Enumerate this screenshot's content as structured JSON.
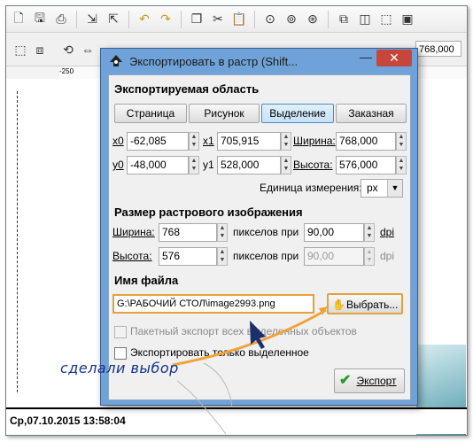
{
  "toolbar": {
    "icons": [
      "new-doc-icon",
      "save-icon",
      "print-icon",
      "import-icon",
      "export-icon",
      "undo-icon",
      "redo-icon",
      "copy-icon",
      "cut-icon",
      "paste-icon",
      "zoom-selection-icon",
      "zoom-drawing-icon",
      "zoom-page-icon",
      "duplicate-icon",
      "clone-icon",
      "unlink-icon"
    ],
    "w_value": "768,000"
  },
  "ruler": {
    "mark": "-250"
  },
  "dialog": {
    "title": "Экспортировать в растр (Shift...",
    "close_label": "✕",
    "minimize_label": "—",
    "export_area": {
      "heading": "Экспортируемая область",
      "buttons": [
        "Страница",
        "Рисунок",
        "Выделение",
        "Заказная"
      ],
      "active": "Выделение",
      "x0_label": "x0",
      "x0_value": "-62,085",
      "x1_label": "x1",
      "x1_value": "705,915",
      "width_label": "Ширина:",
      "width_value": "768,000",
      "y0_label": "y0",
      "y0_value": "-48,000",
      "y1_label": "y1",
      "y1_value": "528,000",
      "height_label": "Высота:",
      "height_value": "576,000",
      "units_label": "Единица измерения:",
      "units_value": "px"
    },
    "bitmap_size": {
      "heading": "Размер растрового изображения",
      "width_label": "Ширина:",
      "width_value": "768",
      "pixels_at_label": "пикселов при",
      "dpi_value": "90,00",
      "dpi_unit": "dpi",
      "height_label": "Высота:",
      "height_value": "576",
      "pixels_at_label2": "пикселов при",
      "dpi_value2": "90,00",
      "dpi_unit2": "dpi"
    },
    "filename": {
      "heading": "Имя файла",
      "path": "G:\\РАБОЧИЙ СТОЛ\\image2993.png",
      "browse_label": "Выбрать..."
    },
    "batch_label": "Пакетный экспорт всех выделенных объектов",
    "selected_only_label": "Экспортировать только выделенное",
    "export_button": "Экспорт"
  },
  "annotation": "сделали выбор",
  "statusbar": {
    "text": "Ср,07.10.2015 13:58:04"
  },
  "colors": {
    "dialog_frame": "#6fa2d8",
    "close_button": "#c7463c",
    "annotation_text": "#16338c"
  }
}
